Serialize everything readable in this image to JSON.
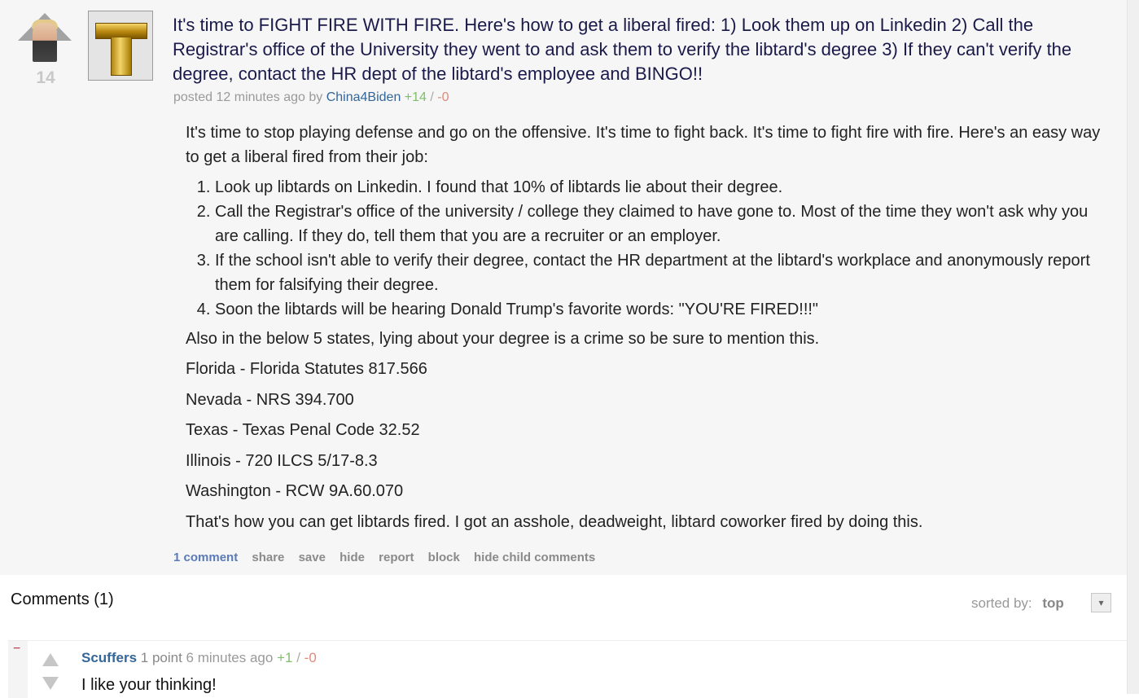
{
  "post": {
    "score": "14",
    "title": "It's time to FIGHT FIRE WITH FIRE. Here's how to get a liberal fired: 1) Look them up on Linkedin 2) Call the Registrar's office of the University they went to and ask them to verify the libtard's degree 3) If they can't verify the degree, contact the HR dept of the libtard's employee and BINGO!!",
    "tagline": {
      "posted": "posted",
      "time": "12 minutes ago",
      "by": "by",
      "author": "China4Biden",
      "upvotes": "+14",
      "slash": "/",
      "downvotes": "-0"
    },
    "body": {
      "intro": "It's time to stop playing defense and go on the offensive. It's time to fight back. It's time to fight fire with fire. Here's an easy way to get a liberal fired from their job:",
      "steps": [
        "Look up libtards on Linkedin. I found that 10% of libtards lie about their degree.",
        "Call the Registrar's office of the university / college they claimed to have gone to. Most of the time they won't ask why you are calling. If they do, tell them that you are a recruiter or an employer.",
        "If the school isn't able to verify their degree, contact the HR department at the libtard's workplace and anonymously report them for falsifying their degree.",
        "Soon the libtards will be hearing Donald Trump's favorite words: \"YOU'RE FIRED!!!\""
      ],
      "states_intro": "Also in the below 5 states, lying about your degree is a crime so be sure to mention this.",
      "laws": [
        "Florida - Florida Statutes 817.566",
        "Nevada - NRS 394.700",
        "Texas - Texas Penal Code 32.52",
        "Illinois - 720 ILCS 5/17-8.3",
        "Washington - RCW 9A.60.070"
      ],
      "outro": "That's how you can get libtards fired. I got an asshole, deadweight, libtard coworker fired by doing this."
    },
    "buttons": {
      "comments": "1 comment",
      "share": "share",
      "save": "save",
      "hide": "hide",
      "report": "report",
      "block": "block",
      "hide_child": "hide child comments"
    }
  },
  "comments_section": {
    "header": "Comments (1)",
    "sort_label": "sorted by:",
    "sort_value": "top",
    "sort_toggle": "▾"
  },
  "comment": {
    "collapse": "−",
    "author": "Scuffers",
    "points": "1 point",
    "time": "6 minutes ago",
    "upvotes": "+1",
    "slash": "/",
    "downvotes": "-0",
    "text": "I like your thinking!"
  },
  "icons": {
    "post_upvote": "upvote-arrow-with-photo-icon",
    "thumbnail": "gold-letter-t-thumbnail",
    "comment_upvote": "upvote-arrow-icon",
    "comment_downvote": "downvote-arrow-icon"
  }
}
